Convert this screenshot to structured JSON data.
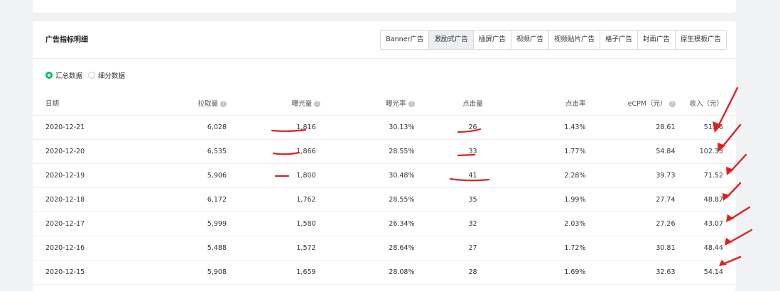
{
  "card": {
    "title": "广告指标明细",
    "tabs": [
      "Banner广告",
      "激励式广告",
      "插屏广告",
      "视频广告",
      "视频贴片广告",
      "格子广告",
      "封面广告",
      "原生模板广告"
    ],
    "active_tab": "激励式广告"
  },
  "radios": {
    "summary": "汇总数据",
    "detail": "细分数据",
    "selected": "汇总数据"
  },
  "table": {
    "headers": {
      "date": "日期",
      "pulls": "拉取量",
      "exposure": "曝光量",
      "exposure_rate": "曝光率",
      "clicks": "点击量",
      "ctr": "点击率",
      "ecpm": "eCPM（元）",
      "revenue": "收入（元）"
    },
    "help_icon": "?",
    "rows": [
      {
        "date": "2020-12-21",
        "pulls": "6,028",
        "exposure": "1,816",
        "rate": "30.13%",
        "clicks": "26",
        "ctr": "1.43%",
        "ecpm": "28.61",
        "revenue": "51.96"
      },
      {
        "date": "2020-12-20",
        "pulls": "6,535",
        "exposure": "1,866",
        "rate": "28.55%",
        "clicks": "33",
        "ctr": "1.77%",
        "ecpm": "54.84",
        "revenue": "102.33"
      },
      {
        "date": "2020-12-19",
        "pulls": "5,906",
        "exposure": "1,800",
        "rate": "30.48%",
        "clicks": "41",
        "ctr": "2.28%",
        "ecpm": "39.73",
        "revenue": "71.52"
      },
      {
        "date": "2020-12-18",
        "pulls": "6,172",
        "exposure": "1,762",
        "rate": "28.55%",
        "clicks": "35",
        "ctr": "1.99%",
        "ecpm": "27.74",
        "revenue": "48.87"
      },
      {
        "date": "2020-12-17",
        "pulls": "5,999",
        "exposure": "1,580",
        "rate": "26.34%",
        "clicks": "32",
        "ctr": "2.03%",
        "ecpm": "27.26",
        "revenue": "43.07"
      },
      {
        "date": "2020-12-16",
        "pulls": "5,488",
        "exposure": "1,572",
        "rate": "28.64%",
        "clicks": "27",
        "ctr": "1.72%",
        "ecpm": "30.81",
        "revenue": "48.44"
      },
      {
        "date": "2020-12-15",
        "pulls": "5,908",
        "exposure": "1,659",
        "rate": "28.08%",
        "clicks": "28",
        "ctr": "1.69%",
        "ecpm": "32.63",
        "revenue": "54.14"
      }
    ]
  },
  "annotation": {
    "color": "#e02020"
  }
}
